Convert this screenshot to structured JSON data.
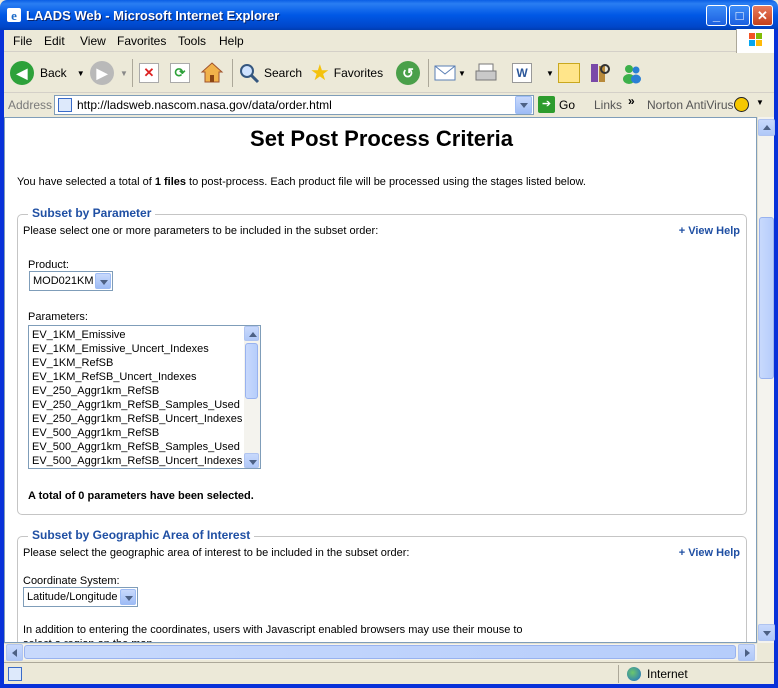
{
  "window": {
    "title": "LAADS Web - Microsoft Internet Explorer",
    "app_icon": "ie-icon",
    "buttons": {
      "minimize": "_",
      "maximize": "□",
      "close": "✕"
    }
  },
  "menu": {
    "items": [
      "File",
      "Edit",
      "View",
      "Favorites",
      "Tools",
      "Help"
    ]
  },
  "toolbar": {
    "back_label": "Back",
    "search_label": "Search",
    "favorites_label": "Favorites"
  },
  "address": {
    "label": "Address",
    "url": "http://ladsweb.nascom.nasa.gov/data/order.html",
    "go_label": "Go",
    "links_label": "Links",
    "norton_label": "Norton AntiVirus"
  },
  "page": {
    "title": "Set Post Process Criteria",
    "intro_prefix": "You have selected a total of ",
    "intro_count": "1 files",
    "intro_suffix": " to post-process. Each product file will be processed using the stages listed below.",
    "subset_param": {
      "legend": "Subset by Parameter",
      "description": "Please select one or more parameters to be included in the subset order:",
      "view_help": "+ View Help",
      "product_label": "Product:",
      "product_value": "MOD021KM",
      "parameters_label": "Parameters:",
      "parameters": [
        "EV_1KM_Emissive",
        "EV_1KM_Emissive_Uncert_Indexes",
        "EV_1KM_RefSB",
        "EV_1KM_RefSB_Uncert_Indexes",
        "EV_250_Aggr1km_RefSB",
        "EV_250_Aggr1km_RefSB_Samples_Used",
        "EV_250_Aggr1km_RefSB_Uncert_Indexes",
        "EV_500_Aggr1km_RefSB",
        "EV_500_Aggr1km_RefSB_Samples_Used",
        "EV_500_Aggr1km_RefSB_Uncert_Indexes"
      ],
      "selected_note": "A total of 0 parameters have been selected."
    },
    "subset_geo": {
      "legend": "Subset by Geographic Area of Interest",
      "description": "Please select the geographic area of interest to be included in the subset order:",
      "view_help": "+ View Help",
      "coord_label": "Coordinate System:",
      "coord_value": "Latitude/Longitude",
      "paragraph": "In addition to entering the coordinates, users with Javascript enabled browsers may use their mouse to select a region on the map."
    }
  },
  "status": {
    "zone": "Internet"
  },
  "colors": {
    "titlebar": "#0058e6",
    "legend": "#1f4fa3",
    "chrome": "#ece9d8"
  }
}
